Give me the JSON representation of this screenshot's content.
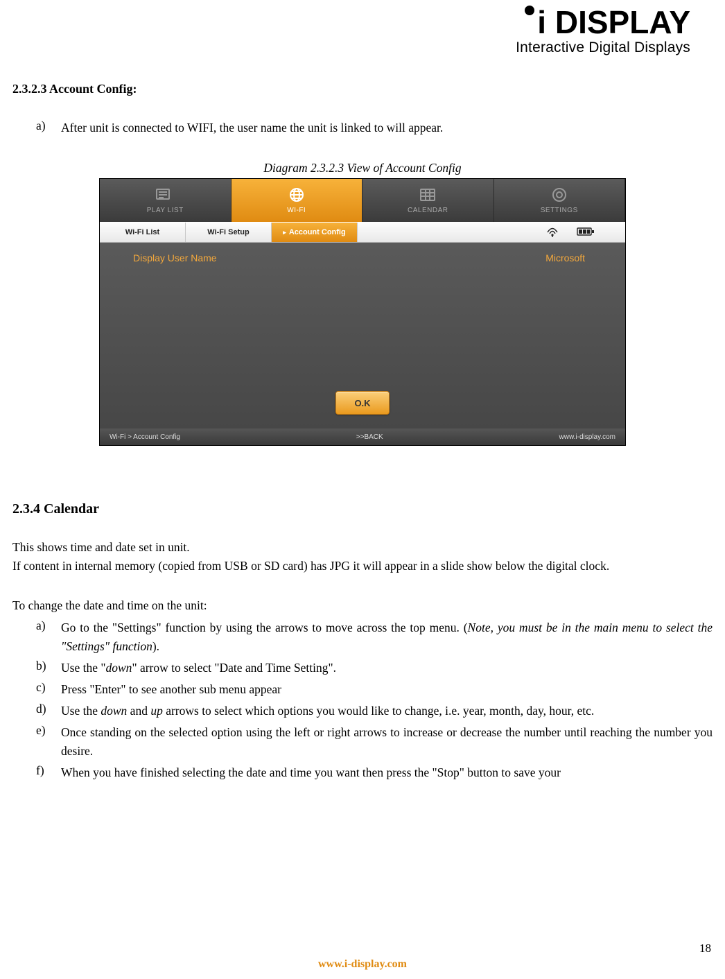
{
  "logo": {
    "main": "i DISPLAY",
    "sub": "Interactive Digital Displays"
  },
  "section_heading_1": "2.3.2.3 Account Config:",
  "intro_item": {
    "marker": "a)",
    "text": "After unit is connected to WIFI, the user name the unit is linked to will appear."
  },
  "diagram_caption": "Diagram 2.3.2.3    View of Account Config",
  "screenshot": {
    "topnav": [
      {
        "label": "PLAY LIST"
      },
      {
        "label": "WI-FI"
      },
      {
        "label": "CALENDAR"
      },
      {
        "label": "SETTINGS"
      }
    ],
    "subtabs": {
      "wifi_list": "Wi-Fi List",
      "wifi_setup": "Wi-Fi Setup",
      "account_config": "Account Config",
      "arrow": "▸"
    },
    "row": {
      "label": "Display User Name",
      "value": "Microsoft"
    },
    "ok_label": "O.K",
    "footer": {
      "left": "Wi-Fi > Account Config",
      "mid": ">>BACK",
      "right": "www.i-display.com"
    }
  },
  "section_heading_2": "2.3.4 Calendar",
  "para1": "This shows time and date set in unit.",
  "para1b": "If content in internal memory (copied from USB or SD card) has JPG it will appear in a slide show below the digital clock.",
  "para2": "To change the date and time on the unit:",
  "steps": [
    {
      "marker": "a)",
      "pre": "Go to the \"Settings\" function by using the arrows to move across the top menu. (",
      "note": "Note, you must be in the main menu to select the \"Settings\" function",
      "post": ")."
    },
    {
      "marker": "b)",
      "pre": "Use the \"",
      "down": "down",
      "post": "\" arrow to select \"Date and Time Setting\"."
    },
    {
      "marker": "c)",
      "text": "Press \"Enter\" to see another sub menu appear"
    },
    {
      "marker": "d)",
      "pre": "Use the ",
      "down": "down",
      "mid": " and ",
      "up": "up",
      "post": " arrows to select which options you would like to change, i.e. year, month, day, hour, etc."
    },
    {
      "marker": "e)",
      "text": "Once standing on the selected option using the left or right arrows to increase or decrease the number until reaching the number you desire."
    },
    {
      "marker": "f)",
      "text": "When you have finished selecting the date and time you want then press the \"Stop\" button to save your"
    }
  ],
  "page_number": "18",
  "footer_url": "www.i-display.com"
}
